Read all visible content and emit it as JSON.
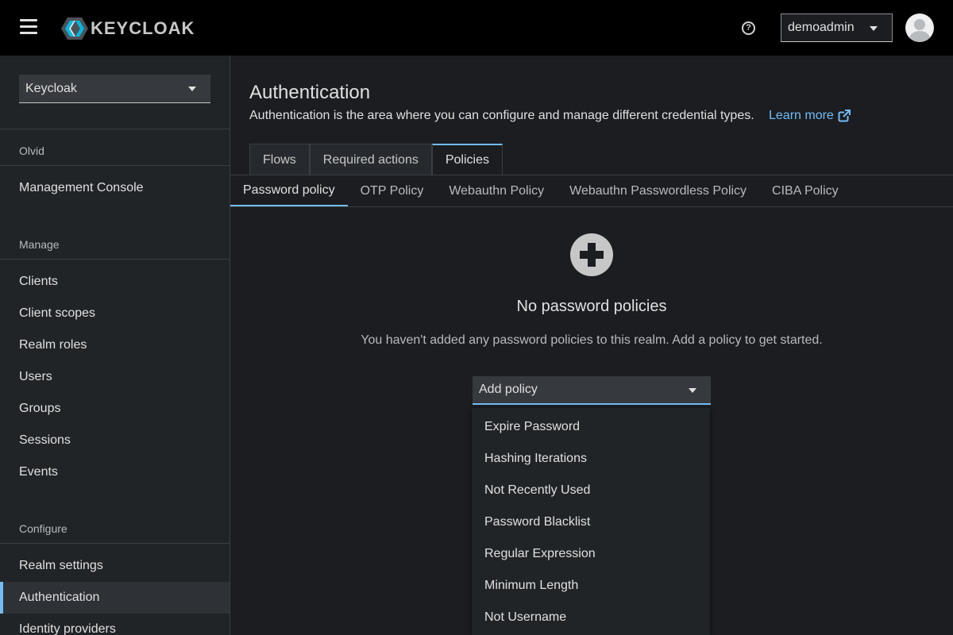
{
  "header": {
    "logo_text": "KEYCLOAK",
    "user_name": "demoadmin",
    "help_glyph": "?",
    "icons": [
      "hamburger-icon",
      "question-circle-icon",
      "caret-down-icon",
      "avatar-icon"
    ]
  },
  "sidebar": {
    "realm": "Keycloak",
    "groups": [
      {
        "title": "Olvid",
        "items": [
          "Management Console"
        ]
      },
      {
        "title": "Manage",
        "items": [
          "Clients",
          "Client scopes",
          "Realm roles",
          "Users",
          "Groups",
          "Sessions",
          "Events"
        ]
      },
      {
        "title": "Configure",
        "items": [
          "Realm settings",
          "Authentication",
          "Identity providers"
        ]
      }
    ],
    "active_item": "Authentication"
  },
  "main": {
    "title": "Authentication",
    "description": "Authentication is the area where you can configure and manage different credential types.",
    "learn_more": "Learn more",
    "tabs": [
      "Flows",
      "Required actions",
      "Policies"
    ],
    "active_tab": "Policies",
    "subtabs": [
      "Password policy",
      "OTP Policy",
      "Webauthn Policy",
      "Webauthn Passwordless Policy",
      "CIBA Policy"
    ],
    "active_subtab": "Password policy",
    "empty_state": {
      "title": "No password policies",
      "body": "You haven't added any password policies to this realm. Add a policy to get started."
    },
    "add_policy": {
      "label": "Add policy",
      "options": [
        "Expire Password",
        "Hashing Iterations",
        "Not Recently Used",
        "Password Blacklist",
        "Regular Expression",
        "Minimum Length",
        "Not Username"
      ]
    }
  },
  "colors": {
    "accent": "#73bcf7",
    "background": "#1b1d21",
    "sidebar": "#212427",
    "masthead": "#000000"
  }
}
